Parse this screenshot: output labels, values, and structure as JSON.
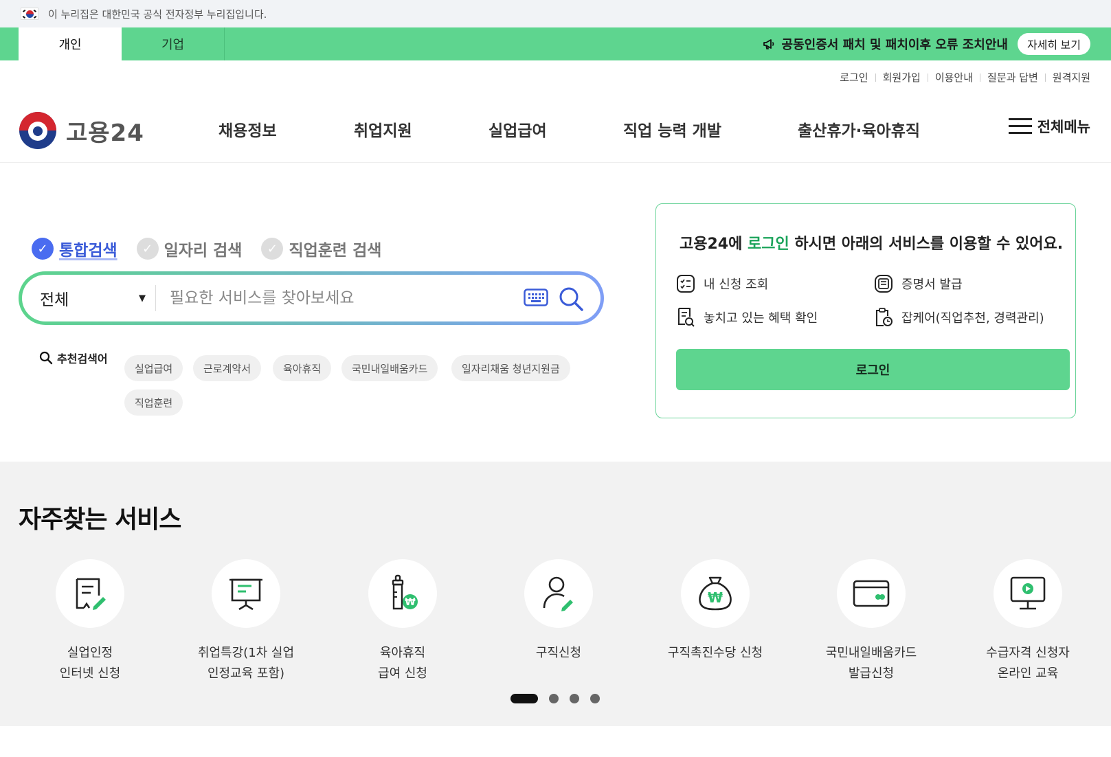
{
  "gov_banner": {
    "text": "이 누리집은 대한민국 공식 전자정부 누리집입니다."
  },
  "top_tabs": [
    {
      "label": "개인"
    },
    {
      "label": "기업"
    }
  ],
  "notice": {
    "text": "공동인증서 패치 및 패치이후 오류 조치안내",
    "button": "자세히 보기"
  },
  "util_links": [
    "로그인",
    "회원가입",
    "이용안내",
    "질문과 답변",
    "원격지원"
  ],
  "logo": {
    "text": "고용24"
  },
  "nav": [
    "채용정보",
    "취업지원",
    "실업급여",
    "직업 능력 개발",
    "출산휴가·육아휴직"
  ],
  "all_menu": "전체메뉴",
  "search_tabs": [
    {
      "label": "통합검색",
      "active": true
    },
    {
      "label": "일자리 검색",
      "active": false
    },
    {
      "label": "직업훈련 검색",
      "active": false
    }
  ],
  "search": {
    "category": "전체",
    "placeholder": "필요한 서비스를 찾아보세요"
  },
  "recommended": {
    "label": "추천검색어",
    "keywords": [
      "실업급여",
      "근로계약서",
      "육아휴직",
      "국민내일배움카드",
      "일자리채움 청년지원금",
      "직업훈련"
    ]
  },
  "login_card": {
    "title_prefix": "고용24에 ",
    "title_highlight": "로그인",
    "title_suffix": " 하시면 아래의 서비스를 이용할 수 있어요.",
    "services": [
      "내 신청 조회",
      "증명서 발급",
      "놓치고 있는 혜택 확인",
      "잡케어(직업추천, 경력관리)"
    ],
    "button": "로그인"
  },
  "frequent": {
    "title": "자주찾는 서비스",
    "items": [
      {
        "label": "실업인정\n인터넷 신청",
        "icon": "document-edit-icon"
      },
      {
        "label": "취업특강(1차 실업\n인정교육 포함)",
        "icon": "presentation-board-icon"
      },
      {
        "label": "육아휴직\n급여 신청",
        "icon": "baby-bottle-won-icon"
      },
      {
        "label": "구직신청",
        "icon": "person-edit-icon"
      },
      {
        "label": "구직촉진수당 신청",
        "icon": "money-bag-icon"
      },
      {
        "label": "국민내일배움카드\n발급신청",
        "icon": "card-icon"
      },
      {
        "label": "수급자격 신청자\n온라인 교육",
        "icon": "monitor-play-icon"
      }
    ],
    "pagination": {
      "current": 1,
      "total": 4
    }
  },
  "colors": {
    "brand_green": "#5ed58f",
    "accent_blue": "#4a6cf0",
    "highlight_green": "#1aa35a"
  }
}
